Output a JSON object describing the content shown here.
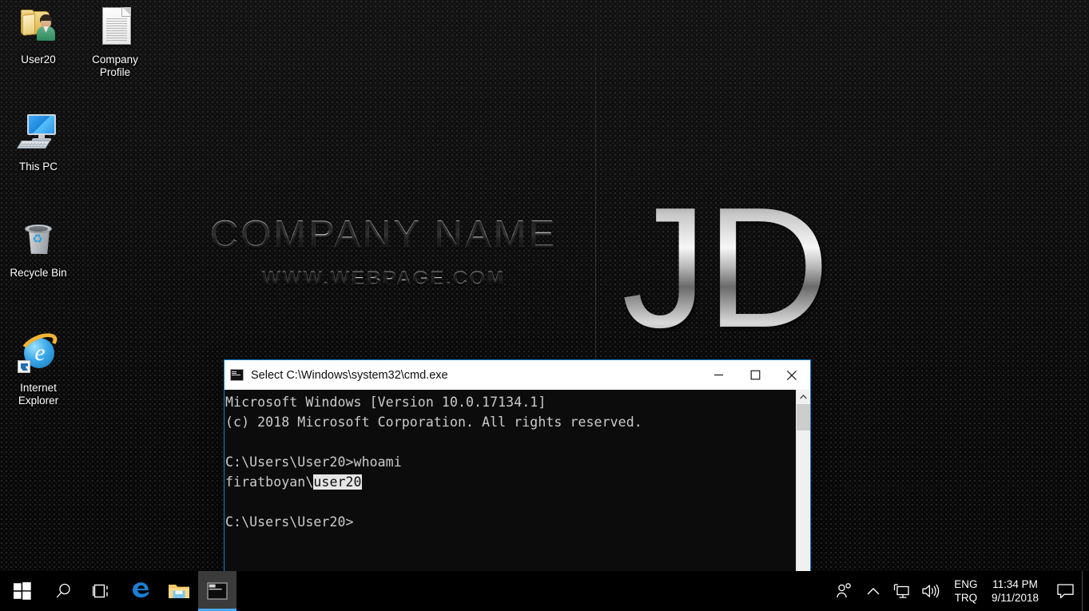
{
  "desktop": {
    "wallpaper": {
      "company_name": "COMPANY NAME",
      "website": "WWW.WEBPAGE.COM",
      "logo_monogram": "JD",
      "background_color": "#0d0d0d"
    },
    "icons": [
      {
        "label": "User20",
        "icon": "user-folder-icon"
      },
      {
        "label": "Company Profile",
        "icon": "document-icon"
      },
      {
        "label": "This PC",
        "icon": "computer-icon"
      },
      {
        "label": "Recycle Bin",
        "icon": "recycle-bin-icon"
      },
      {
        "label": "Internet Explorer",
        "icon": "internet-explorer-icon"
      }
    ]
  },
  "window": {
    "title": "Select C:\\Windows\\system32\\cmd.exe",
    "icon": "cmd-icon",
    "controls": {
      "minimize": "Minimize",
      "maximize": "Maximize",
      "close": "Close"
    },
    "border_color": "#0a84dd",
    "console": {
      "background_color": "#0c0c0c",
      "text_color": "#cccccc",
      "selection_background": "#e6e6e6",
      "lines": [
        "Microsoft Windows [Version 10.0.17134.1]",
        "(c) 2018 Microsoft Corporation. All rights reserved.",
        "",
        "C:\\Users\\User20>whoami",
        "firatboyan\\user20",
        "",
        "C:\\Users\\User20>"
      ],
      "selected_text": "user20",
      "prompt_line_prefix": "firatboyan\\"
    },
    "scrollbar": {
      "up_arrow": "▲"
    }
  },
  "taskbar": {
    "background_color": "#000000",
    "accent_color": "#4aa8ef",
    "buttons": [
      {
        "name": "start-button",
        "icon": "windows-logo-icon",
        "label": "Start",
        "active": false
      },
      {
        "name": "search-button",
        "icon": "search-icon",
        "label": "Search",
        "active": false
      },
      {
        "name": "task-view-button",
        "icon": "task-view-icon",
        "label": "Task View",
        "active": false
      },
      {
        "name": "edge-button",
        "icon": "edge-icon",
        "label": "Microsoft Edge",
        "active": false
      },
      {
        "name": "file-explorer-button",
        "icon": "folder-icon",
        "label": "File Explorer",
        "active": false
      },
      {
        "name": "cmd-taskbar-button",
        "icon": "cmd-icon",
        "label": "Command Prompt",
        "active": true
      }
    ],
    "tray": {
      "people_icon": "people-icon",
      "chevron_icon": "chevron-up-icon",
      "network_icon": "network-monitor-icon",
      "volume_icon": "speaker-icon",
      "language_primary": "ENG",
      "language_secondary": "TRQ",
      "time": "11:34 PM",
      "date": "9/11/2018",
      "action_center_icon": "action-center-icon"
    }
  }
}
